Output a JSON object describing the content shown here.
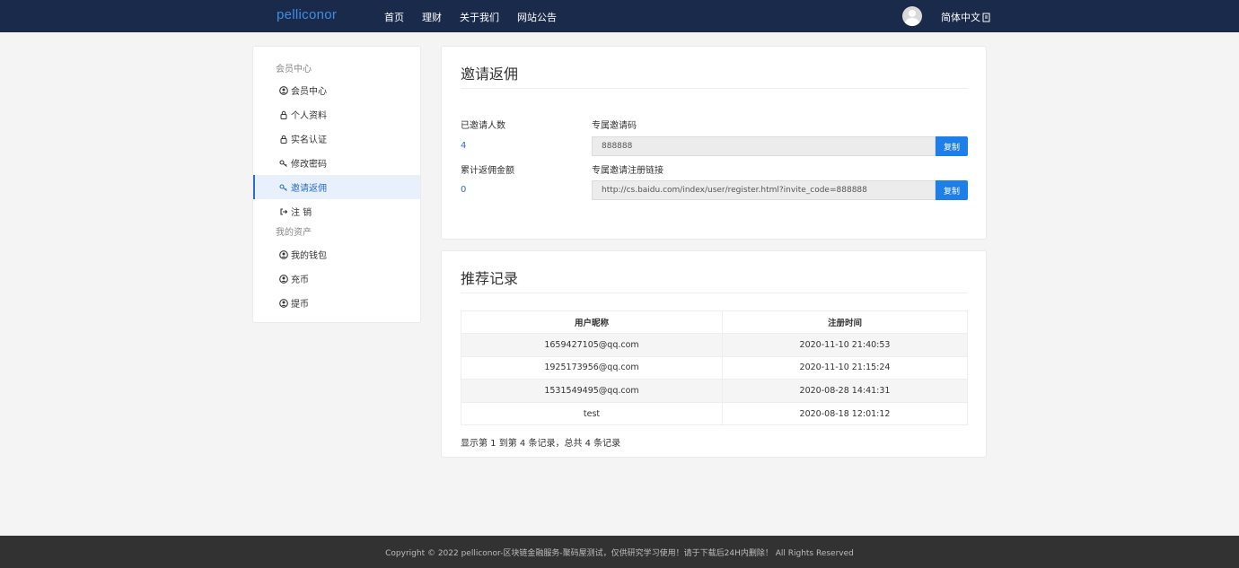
{
  "navbar": {
    "brand": "pelliconor",
    "links": [
      "首页",
      "理财",
      "关于我们",
      "网站公告"
    ],
    "language": "简体中文"
  },
  "sidebar": {
    "section_member": "会员中心",
    "member_items": [
      {
        "label": "会员中心",
        "icon": "user-circle-icon"
      },
      {
        "label": "个人资料",
        "icon": "lock-icon"
      },
      {
        "label": "实名认证",
        "icon": "lock-icon"
      },
      {
        "label": "修改密码",
        "icon": "key-icon"
      },
      {
        "label": "邀请返佣",
        "icon": "key-icon",
        "active": true
      },
      {
        "label": "注 销",
        "icon": "logout-icon"
      }
    ],
    "section_assets": "我的资产",
    "asset_items": [
      {
        "label": "我的钱包",
        "icon": "user-circle-icon"
      },
      {
        "label": "充币",
        "icon": "user-circle-icon"
      },
      {
        "label": "提币",
        "icon": "user-circle-icon"
      }
    ]
  },
  "invite_panel": {
    "title": "邀请返佣",
    "invited_count_label": "已邀请人数",
    "invited_count": "4",
    "total_rebate_label": "累计返佣金额",
    "total_rebate": "0",
    "invite_code_label": "专属邀请码",
    "invite_code": "888888",
    "invite_link_label": "专属邀请注册链接",
    "invite_link": "http://cs.baidu.com/index/user/register.html?invite_code=888888",
    "copy_label": "复制"
  },
  "records_panel": {
    "title": "推荐记录",
    "columns": [
      "用户昵称",
      "注册时间"
    ],
    "rows": [
      [
        "1659427105@qq.com",
        "2020-11-10 21:40:53"
      ],
      [
        "1925173956@qq.com",
        "2020-11-10 21:15:24"
      ],
      [
        "1531549495@qq.com",
        "2020-08-28 14:41:31"
      ],
      [
        "test",
        "2020-08-18 12:01:12"
      ]
    ],
    "summary": "显示第 1 到第 4 条记录，总共 4 条记录"
  },
  "footer": {
    "text": "Copyright © 2022 pelliconor-区块链金融服务-聚码屋测试，仅供研究学习使用！请于下载后24H内删除！ All Rights Reserved"
  },
  "colors": {
    "navbar_bg": "#1a2a4a",
    "brand": "#3d8ee8",
    "accent": "#1e7fe6",
    "footer_bg": "#323232"
  }
}
